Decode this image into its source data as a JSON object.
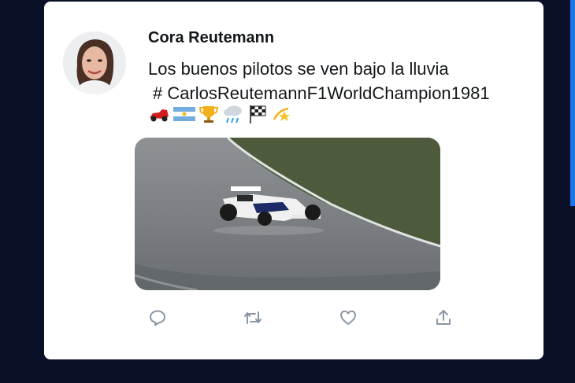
{
  "tweet": {
    "author": "Cora Reutemann",
    "text": "Los buenos pilotos se ven bajo la lluvia",
    "hashtag": "# CarlosReutemannF1WorldChampion1981"
  },
  "emojis": [
    "race-car",
    "argentina-flag",
    "trophy",
    "rain-cloud",
    "checkered-flag",
    "dizzy-star"
  ],
  "actions": [
    "reply-icon",
    "retweet-icon",
    "like-icon",
    "share-icon"
  ],
  "colors": {
    "background": "#0a1028",
    "card": "#ffffff",
    "accent": "#1d76e6",
    "icon": "#8a96a3",
    "text": "#14171a"
  }
}
